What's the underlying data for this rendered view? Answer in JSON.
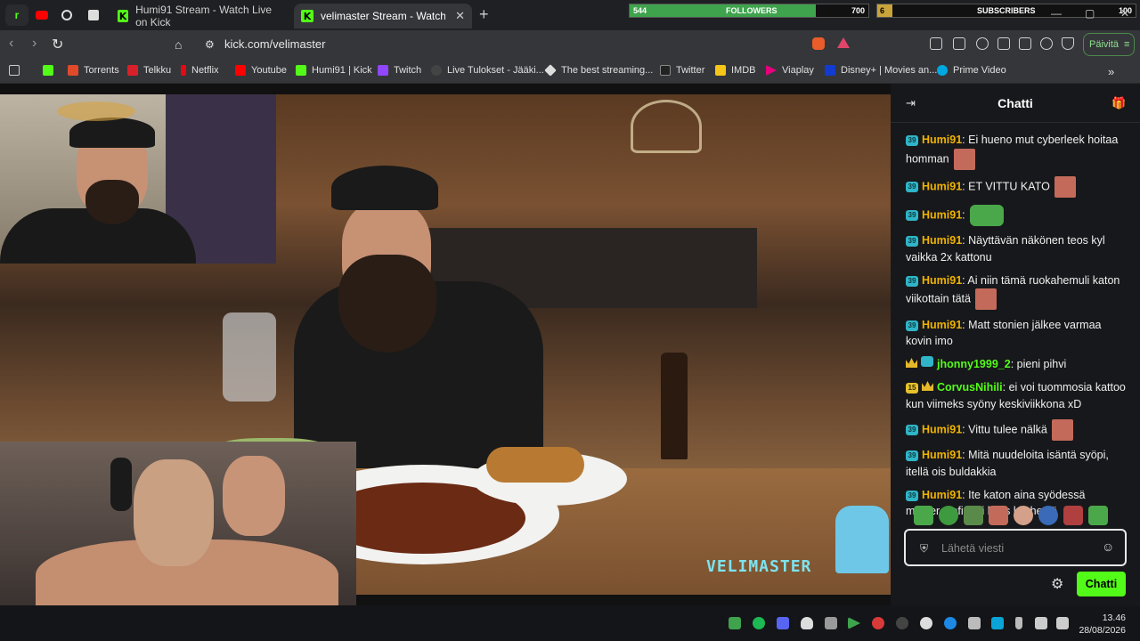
{
  "browser": {
    "tabs": [
      {
        "title": "Humi91 Stream - Watch Live on Kick",
        "active": false
      },
      {
        "title": "velimaster Stream - Watch Live",
        "active": true
      }
    ],
    "address": "kick.com/velimaster",
    "update_label": "Päivitä"
  },
  "overlay": {
    "followers": {
      "label": "FOLLOWERS",
      "current": "544",
      "goal": "700",
      "progress": 0.78
    },
    "subscribers": {
      "label": "SUBSCRIBERS",
      "current": "6",
      "goal": "100",
      "progress": 0.06
    }
  },
  "bookmarks": [
    {
      "label": "Torrents",
      "color": "#e04a2a"
    },
    {
      "label": "Telkku",
      "color": "#d8202a"
    },
    {
      "label": "Netflix",
      "color": "#e50914"
    },
    {
      "label": "Youtube",
      "color": "#ff0000"
    },
    {
      "label": "Humi91 | Kick",
      "color": "#53fc18"
    },
    {
      "label": "Twitch",
      "color": "#9146ff"
    },
    {
      "label": "Live Tulokset - Jääki...",
      "color": "#444444"
    },
    {
      "label": "The best streaming...",
      "color": "#dddddd"
    },
    {
      "label": "Twitter",
      "color": "#222222"
    },
    {
      "label": "IMDB",
      "color": "#f5c518"
    },
    {
      "label": "Viaplay",
      "color": "#e6007e"
    },
    {
      "label": "Disney+ | Movies an...",
      "color": "#113ccf"
    },
    {
      "label": "Prime Video",
      "color": "#00a8e1"
    }
  ],
  "stream": {
    "watermark": "VELIMASTER"
  },
  "chat": {
    "title": "Chatti",
    "messages": [
      {
        "badge": "39",
        "user": "Humi91",
        "color": "#f0b400",
        "text": "Ei hueno mut cyberleek hoitaa homman",
        "emote": true
      },
      {
        "badge": "39",
        "user": "Humi91",
        "color": "#f0b400",
        "text": "ET VITTU KATO",
        "emote": true
      },
      {
        "badge": "39",
        "user": "Humi91",
        "color": "#f0b400",
        "text": "",
        "emote": true,
        "frog": true
      },
      {
        "badge": "39",
        "user": "Humi91",
        "color": "#f0b400",
        "text": "Näyttävän näkönen teos kyl vaikka 2x kattonu"
      },
      {
        "badge": "39",
        "user": "Humi91",
        "color": "#f0b400",
        "text": "Ai niin tämä ruokahemuli katon viikottain tätä",
        "emote": true
      },
      {
        "badge": "39",
        "user": "Humi91",
        "color": "#f0b400",
        "text": "Matt stonien jälkee varmaa kovin imo"
      },
      {
        "badge": "crown",
        "user": "jhonny1999_2",
        "color": "#53fc18",
        "text": "pieni pihvi"
      },
      {
        "badge": "15",
        "user": "CorvusNihili",
        "color": "#53fc18",
        "text": "ei voi tuommosia kattoo kun viimeks syöny keskiviikkona xD"
      },
      {
        "badge": "39",
        "user": "Humi91",
        "color": "#f0b400",
        "text": "Vittu tulee nälkä",
        "emote": true
      },
      {
        "badge": "39",
        "user": "Humi91",
        "color": "#f0b400",
        "text": "Mitä nuudeloita isäntä syöpi, itellä ois buldakkia"
      },
      {
        "badge": "39",
        "user": "Humi91",
        "color": "#f0b400",
        "text": "Ite katon aina syödessä masterchefiä tai hells kitcheniä"
      }
    ],
    "input_placeholder": "Lähetä viesti",
    "send_label": "Chatti"
  },
  "taskbar": {
    "time": "13.46",
    "date": "28/08/2026"
  }
}
